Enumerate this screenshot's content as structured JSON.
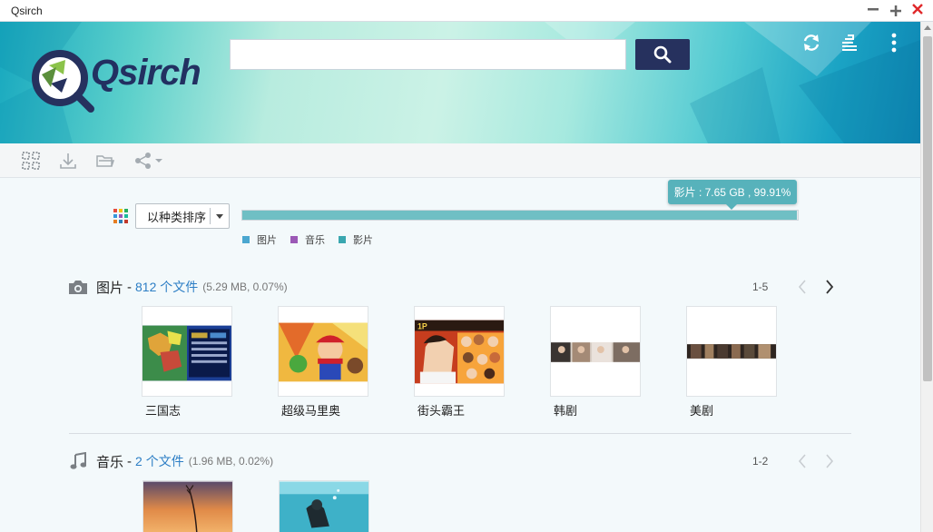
{
  "window": {
    "title": "Qsirch"
  },
  "header": {
    "logo_text": "Qsirch",
    "search_value": "",
    "icons": [
      "refresh-icon",
      "storage-stack-icon",
      "more-vertical-icon"
    ]
  },
  "toolbar": {
    "icons": [
      "select-all-icon",
      "download-icon",
      "open-folder-icon",
      "share-icon"
    ]
  },
  "sort": {
    "label": "以种类排序"
  },
  "storage": {
    "tooltip": "影片 : 7.65 GB , 99.91%",
    "video_fraction": 0.9991,
    "legend": [
      {
        "label": "图片",
        "color": "#4ba7d0"
      },
      {
        "label": "音乐",
        "color": "#9b59b6"
      },
      {
        "label": "影片",
        "color": "#3aa7b0"
      }
    ]
  },
  "sections": [
    {
      "name": "图片",
      "dash": "-",
      "count": "812 个文件",
      "meta": "(5.29 MB, 0.07%)",
      "range": "1-5",
      "items": [
        {
          "label": "三国志"
        },
        {
          "label": "超级马里奥"
        },
        {
          "label": "街头霸王"
        },
        {
          "label": "韩剧"
        },
        {
          "label": "美剧"
        }
      ]
    },
    {
      "name": "音乐",
      "dash": "-",
      "count": "2 个文件",
      "meta": "(1.96 MB, 0.02%)",
      "range": "1-2",
      "items": []
    }
  ],
  "colors": {
    "accent": "#26315e",
    "link": "#2d7ec5",
    "storage": "#6fbfc4"
  }
}
